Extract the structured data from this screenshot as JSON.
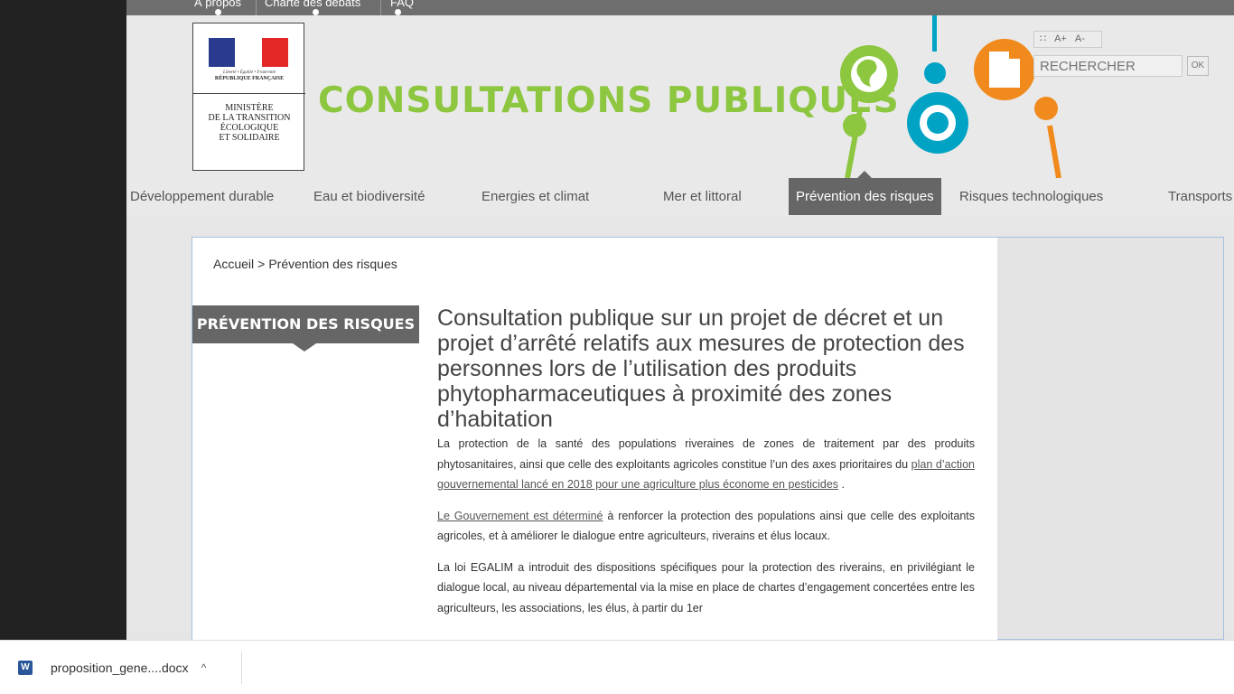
{
  "topbar": {
    "links": [
      "À propos",
      "Charte des débats",
      "FAQ"
    ]
  },
  "logo": {
    "motto": "Liberté • Égalité • Fraternité",
    "republic": "RÉPUBLIQUE FRANÇAISE",
    "ministry": "MINISTÈRE\nDE LA TRANSITION\nÉCOLOGIQUE\nET SOLIDAIRE"
  },
  "site_title": "CONSULTATIONS PUBLIQUES",
  "tools": {
    "rss_icon": "rss-icon",
    "font_increase": "A+",
    "font_decrease": "A-"
  },
  "search": {
    "placeholder": "RECHERCHER",
    "button_label": "OK"
  },
  "nav": {
    "items": [
      {
        "label": "Développement durable",
        "active": false
      },
      {
        "label": "Eau et biodiversité",
        "active": false
      },
      {
        "label": "Energies et climat",
        "active": false
      },
      {
        "label": "Mer et littoral",
        "active": false
      },
      {
        "label": "Prévention des risques",
        "active": true
      },
      {
        "label": "Risques technologiques",
        "active": false
      },
      {
        "label": "Transports",
        "active": false
      }
    ]
  },
  "breadcrumb": {
    "home": "Accueil",
    "separator": ">",
    "current": "Prévention des risques"
  },
  "section_tag": "PRÉVENTION DES RISQUES",
  "article": {
    "title": "Consultation publique sur un projet de décret et un projet d’arrêté relatifs aux mesures de protection des personnes lors de l’utilisation des produits phytopharmaceutiques à proximité des zones d’habitation",
    "p1_text": "La protection de la santé des populations riveraines de zones de traitement par des produits phytosanitaires, ainsi que celle des exploitants agricoles constitue l’un des axes prioritaires du ",
    "p1_link": "plan d’action gouvernemental lancé en 2018 pour une agriculture plus économe en pesticides",
    "p1_end": " .",
    "p2_link": "Le Gouvernement est déterminé",
    "p2_text": " à renforcer la protection des populations ainsi que celle des exploitants agricoles, et à améliorer le dialogue entre agriculteurs, riverains et élus locaux.",
    "p3_text": "La loi EGALIM a introduit des dispositions spécifiques pour la protection des riverains, en privilégiant le dialogue local, au niveau départemental via la mise en place de chartes d’engagement concertées entre les agriculteurs, les associations, les élus, à partir du 1er"
  },
  "download": {
    "filename": "proposition_gene....docx",
    "file_icon": "word-document-icon",
    "chevron": "^"
  },
  "colors": {
    "brand_green": "#8dc63f",
    "nav_active": "#666666",
    "deco_teal": "#00a3c4",
    "deco_orange": "#f08a1c"
  }
}
